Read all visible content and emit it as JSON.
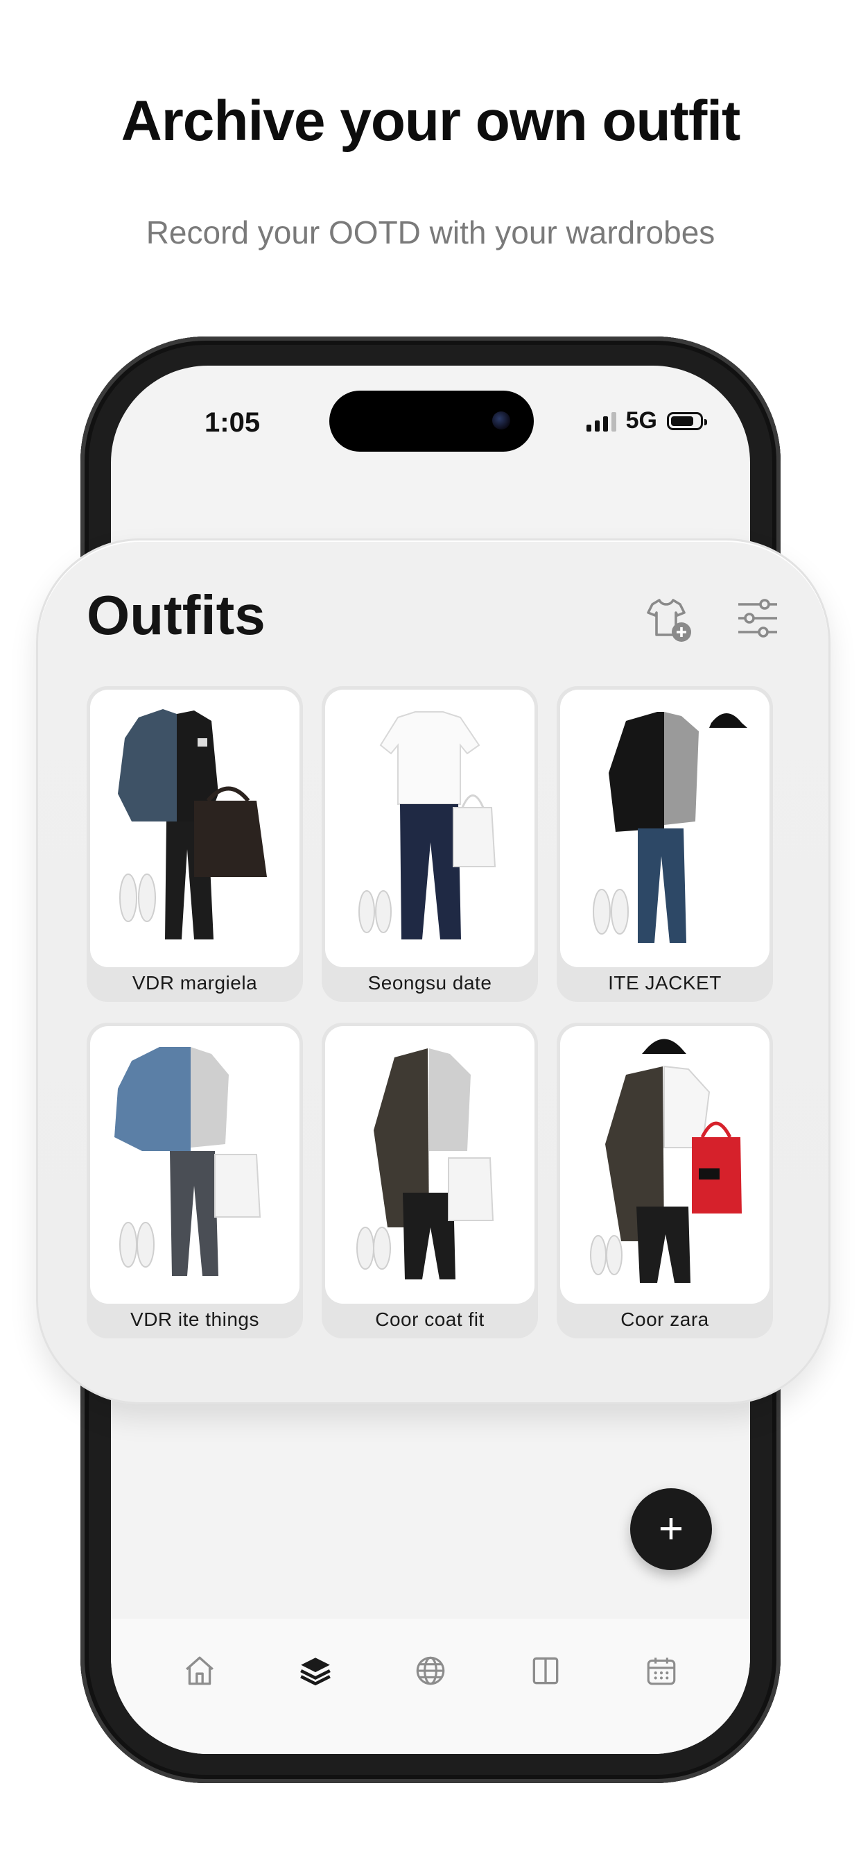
{
  "headline": "Archive your own outfit",
  "subheadline": "Record your OOTD with your wardrobes",
  "status_bar": {
    "time": "1:05",
    "network": "5G"
  },
  "page_title": "Outfits",
  "toolbar": {
    "add_clothing_icon": "shirt-plus-icon",
    "filter_icon": "sliders-icon"
  },
  "outfits": [
    {
      "name": "VDR margiela"
    },
    {
      "name": "Seongsu date"
    },
    {
      "name": "ITE JACKET"
    },
    {
      "name": "VDR ite things"
    },
    {
      "name": "Coor coat fit"
    },
    {
      "name": "Coor zara"
    }
  ],
  "fab": {
    "label": "+"
  },
  "bottom_nav": [
    {
      "icon": "home-icon",
      "active": false
    },
    {
      "icon": "layers-icon",
      "active": true
    },
    {
      "icon": "globe-icon",
      "active": false
    },
    {
      "icon": "book-icon",
      "active": false
    },
    {
      "icon": "calendar-icon",
      "active": false
    }
  ],
  "colors": {
    "accent": "#1a1a1a",
    "muted": "#7a7a7a",
    "bag_red": "#d6212b"
  }
}
